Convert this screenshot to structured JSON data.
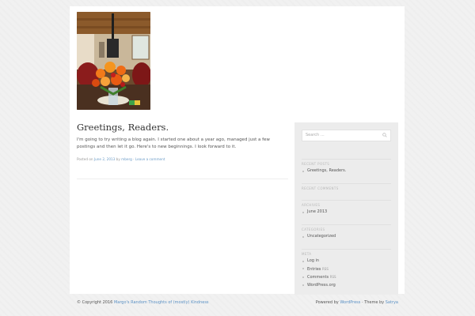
{
  "post": {
    "title": "Greetings, Readers.",
    "body": "I'm going to try writing a blog again. I started one about a year ago, managed just a few postings and then let it go. Here's to new beginnings. I look forward to it.",
    "meta_posted_on": "Posted on",
    "meta_date": "June 2, 2013",
    "meta_by": "by",
    "meta_author": "mberg",
    "meta_separator": "·",
    "meta_comment": "Leave a comment"
  },
  "sidebar": {
    "search_placeholder": "Search …",
    "recent_posts": {
      "title": "Recent Posts",
      "items": [
        "Greetings, Readers."
      ]
    },
    "recent_comments": {
      "title": "Recent Comments"
    },
    "archives": {
      "title": "Archives",
      "items": [
        "June 2013"
      ]
    },
    "categories": {
      "title": "Categories",
      "items": [
        "Uncategorized"
      ]
    },
    "meta": {
      "title": "Meta",
      "items": [
        {
          "label": "Log in"
        },
        {
          "label": "Entries",
          "suffix": "RSS"
        },
        {
          "label": "Comments",
          "suffix": "RSS"
        },
        {
          "label": "WordPress.org"
        }
      ]
    }
  },
  "footer": {
    "copyright": "© Copyright 2016",
    "site_name": "Margo's Random Thoughts of (mostly) Kindness",
    "powered_by": "Powered by",
    "wordpress": "WordPress",
    "theme_by": "· Theme by",
    "theme_author": "Satrya"
  },
  "icons": {
    "search": "search-icon"
  },
  "colors": {
    "link": "#6a9bc7",
    "sidebar_bg": "#ececec",
    "page_bg": "#f1f1f1"
  }
}
